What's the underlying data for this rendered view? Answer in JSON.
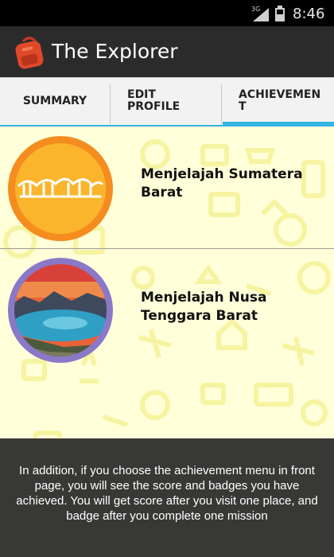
{
  "status_bar": {
    "network": "3G",
    "time": "8:46",
    "icons": [
      "signal-icon",
      "battery-icon"
    ]
  },
  "action_bar": {
    "title": "The Explorer",
    "icon": "backpack-icon",
    "accent_color": "#d9452b"
  },
  "tabs": [
    {
      "label": "SUMMARY"
    },
    {
      "label": "EDIT PROFILE"
    },
    {
      "label": "ACHIEVEMENT",
      "selected": true
    }
  ],
  "tab_indicator_color": "#33b5e5",
  "achievements": [
    {
      "title": "Menjelajah Sumatera Barat",
      "badge": "rumah-gadang-badge-icon",
      "badge_color": "#f7a21d"
    },
    {
      "title": "Menjelajah Nusa Tenggara Barat",
      "badge": "rinjani-lake-badge-icon",
      "badge_color": "#8a78c8"
    }
  ],
  "overlay": {
    "text": "In addition, if you choose the achievement menu in front page, you will see the score and badges you have achieved. You will get score after you visit one place, and badge after you complete one mission"
  }
}
